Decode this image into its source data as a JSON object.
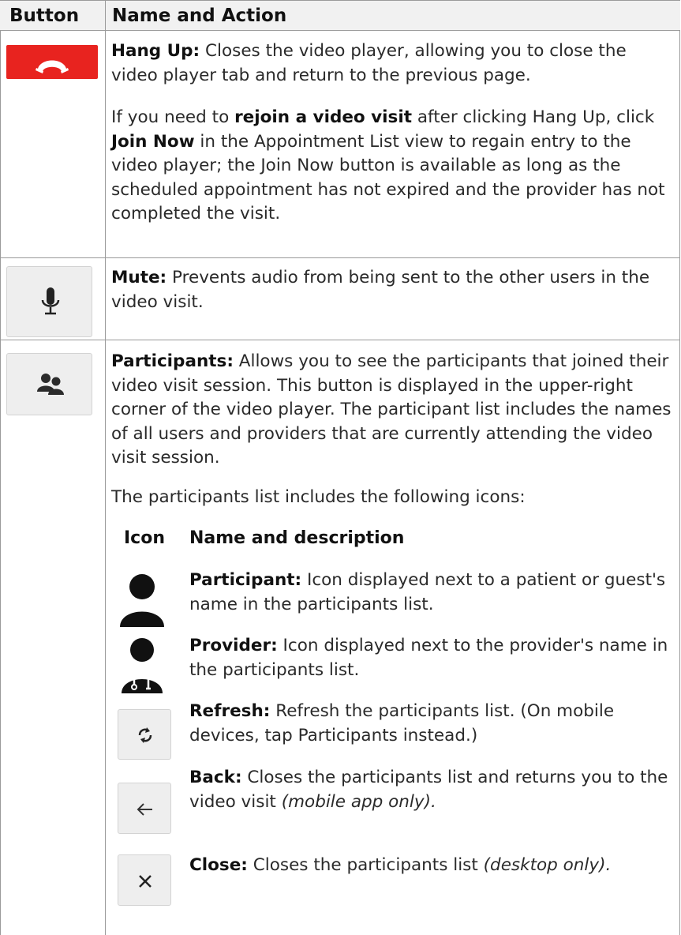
{
  "header": {
    "col_button": "Button",
    "col_name_action": "Name and Action"
  },
  "rows": {
    "hangup": {
      "name": "Hang Up:",
      "desc": " Closes the video player, allowing you to close the video player tab and return to the previous page.",
      "p2_a": "If you need to ",
      "p2_b": "rejoin a video visit",
      "p2_c": " after clicking Hang Up, click ",
      "p2_d": "Join Now",
      "p2_e": " in the Appointment List view to regain entry to the video player; the Join Now button is available as long as the scheduled appointment has not expired and the provider has not completed the visit."
    },
    "mute": {
      "name": "Mute:",
      "desc": " Prevents audio from being sent to the other users in the video visit."
    },
    "participants": {
      "name": "Participants:",
      "desc": " Allows you to see the participants that joined their video visit session. This button is displayed in the upper-right corner of the video player. The participant list includes the names of all users and providers that are currently attending the video visit session.",
      "icons_intro": "The participants list includes the following icons:"
    }
  },
  "icon_table": {
    "col_icon": "Icon",
    "col_name_desc": "Name and description",
    "items": [
      {
        "name": "Participant:",
        "desc": " Icon displayed next to a patient or guest's name in the participants list.",
        "desc_italic": ""
      },
      {
        "name": "Provider:",
        "desc": " Icon displayed next to the provider's name in the participants list.",
        "desc_italic": ""
      },
      {
        "name": "Refresh:",
        "desc": " Refresh the participants list. (On mobile devices, tap Participants instead.)",
        "desc_italic": ""
      },
      {
        "name": "Back:",
        "desc": " Closes the participants list and returns you to the video visit ",
        "desc_italic": "(mobile app only)."
      },
      {
        "name": "Close:",
        "desc": " Closes the participants list ",
        "desc_italic": "(desktop only)."
      }
    ]
  },
  "icons": {
    "hangup": "phone-hangup-icon",
    "mute": "microphone-icon",
    "participants": "participants-icon",
    "participant": "person-icon",
    "provider": "doctor-icon",
    "refresh": "refresh-icon",
    "back": "arrow-left-icon",
    "close": "close-x-icon"
  },
  "colors": {
    "hangup_bg": "#e8231f",
    "header_bg": "#f1f1f1",
    "border": "#9a9a9a",
    "button_bg": "#eeeeee"
  }
}
